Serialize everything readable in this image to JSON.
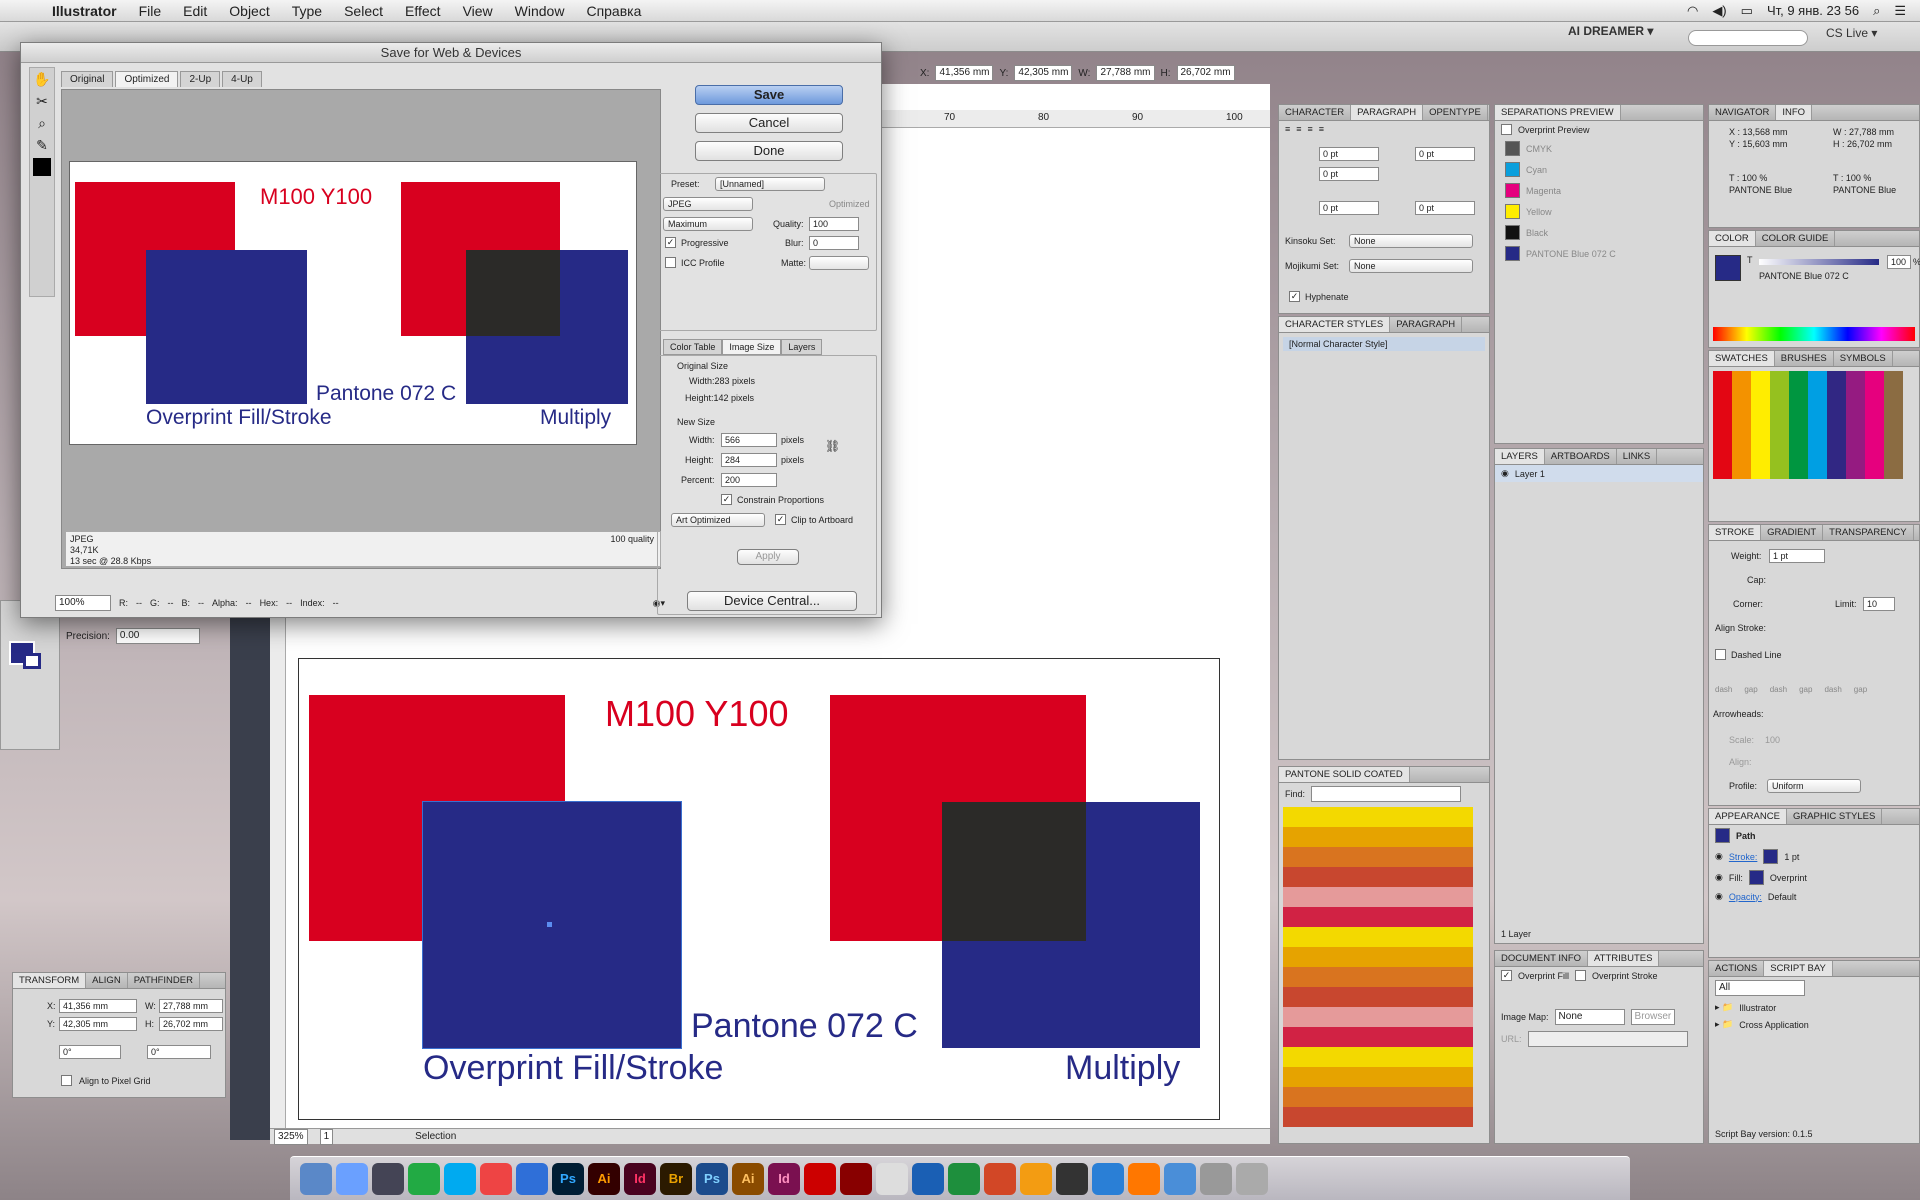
{
  "menubar": {
    "app": "Illustrator",
    "items": [
      "File",
      "Edit",
      "Object",
      "Type",
      "Select",
      "Effect",
      "View",
      "Window",
      "Справка"
    ],
    "clock": "Чт, 9 янв.  23 56"
  },
  "controlbar": {
    "workspace": "AI DREAMER ▾",
    "cslive": "CS Live ▾",
    "x_label": "X:",
    "x_value": "41,356 mm",
    "y_label": "Y:",
    "y_value": "42,305 mm",
    "w_label": "W:",
    "w_value": "27,788 mm",
    "h_label": "H:",
    "h_value": "26,702 mm"
  },
  "dialog": {
    "title": "Save for Web & Devices",
    "tabs": [
      "Original",
      "Optimized",
      "2-Up",
      "4-Up"
    ],
    "active_tab": "Optimized",
    "preview_text": {
      "m100y100": "M100 Y100",
      "pantone": "Pantone 072 C",
      "overprint": "Overprint Fill/Stroke",
      "multiply": "Multiply"
    },
    "info": {
      "format": "JPEG",
      "size": "34,71K",
      "time": "13 sec @ 28.8 Kbps",
      "quality": "100 quality"
    },
    "bottom": {
      "zoom": "100%",
      "r": "R:",
      "r_val": "--",
      "g": "G:",
      "g_val": "--",
      "b": "B:",
      "b_val": "--",
      "alpha": "Alpha:",
      "alpha_val": "--",
      "hex": "Hex:",
      "hex_val": "--",
      "index": "Index:",
      "index_val": "--"
    },
    "buttons": {
      "save": "Save",
      "cancel": "Cancel",
      "done": "Done",
      "device_central": "Device Central...",
      "apply": "Apply"
    },
    "preset_label": "Preset:",
    "preset_value": "[Unnamed]",
    "format_value": "JPEG",
    "compression": "Maximum",
    "optimized_label": "Optimized",
    "quality_label": "Quality:",
    "quality_value": "100",
    "progressive_label": "Progressive",
    "blur_label": "Blur:",
    "blur_value": "0",
    "icc_label": "ICC Profile",
    "matte_label": "Matte:",
    "subtabs": [
      "Color Table",
      "Image Size",
      "Layers"
    ],
    "original_size_label": "Original Size",
    "orig_width": "Width:283 pixels",
    "orig_height": "Height:142 pixels",
    "new_size_label": "New Size",
    "width_label": "Width:",
    "width_value": "566",
    "height_label": "Height:",
    "height_value": "284",
    "pixels": "pixels",
    "percent_label": "Percent:",
    "percent_value": "200",
    "constrain_label": "Constrain Proportions",
    "art_optimized": "Art Optimized",
    "clip_label": "Clip to Artboard"
  },
  "precision": {
    "label": "Precision:",
    "value": "0.00"
  },
  "artboard_text": {
    "m100y100": "M100 Y100",
    "pantone": "Pantone 072 C",
    "overprint": "Overprint Fill/Stroke",
    "multiply": "Multiply"
  },
  "ruler_top": [
    "70",
    "80",
    "90",
    "100"
  ],
  "statusbar": {
    "zoom": "325%",
    "page": "1",
    "tool": "Selection"
  },
  "transform_panel": {
    "tabs": [
      "TRANSFORM",
      "ALIGN",
      "PATHFINDER"
    ],
    "x": "41,356 mm",
    "y": "42,305 mm",
    "w": "27,788 mm",
    "h": "26,702 mm",
    "angle": "0°",
    "shear": "0°",
    "align_grid": "Align to Pixel Grid",
    "x_label": "X:",
    "y_label": "Y:",
    "w_label": "W:",
    "h_label": "H:"
  },
  "character_panel": {
    "tabs": [
      "CHARACTER",
      "PARAGRAPH",
      "OPENTYPE"
    ],
    "pt": "0 pt",
    "kinsoku_label": "Kinsoku Set:",
    "kinsoku_value": "None",
    "mojikumi_label": "Mojikumi Set:",
    "mojikumi_value": "None",
    "hyphenate": "Hyphenate"
  },
  "charstyles_panel": {
    "tabs": [
      "CHARACTER STYLES",
      "PARAGRAPH"
    ],
    "item": "[Normal Character Style]"
  },
  "pantone_panel": {
    "title": "PANTONE SOLID COATED",
    "find": "Find:"
  },
  "separations_panel": {
    "title": "SEPARATIONS PREVIEW",
    "overprint_preview": "Overprint Preview",
    "items": [
      {
        "name": "CMYK",
        "color": "#555555"
      },
      {
        "name": "Cyan",
        "color": "#0b9fdc"
      },
      {
        "name": "Magenta",
        "color": "#e5007e"
      },
      {
        "name": "Yellow",
        "color": "#ffed00"
      },
      {
        "name": "Black",
        "color": "#111111"
      },
      {
        "name": "PANTONE Blue 072 C",
        "color": "#262a86"
      }
    ]
  },
  "layers_panel": {
    "tabs": [
      "LAYERS",
      "ARTBOARDS",
      "LINKS"
    ],
    "layer": "Layer 1",
    "count": "1 Layer"
  },
  "docinfo_panel": {
    "tabs": [
      "DOCUMENT INFO",
      "ATTRIBUTES"
    ],
    "overprint_fill": "Overprint Fill",
    "overprint_stroke": "Overprint Stroke",
    "image_map_label": "Image Map:",
    "image_map_value": "None",
    "browser": "Browser",
    "url": "URL:"
  },
  "navigator_panel": {
    "tabs": [
      "NAVIGATOR",
      "INFO"
    ],
    "x": "X : 13,568 mm",
    "y": "Y : 15,603 mm",
    "w": "W : 27,788 mm",
    "h": "H : 26,702 mm",
    "t1": "T :  100 %",
    "t2": "T :  100 %",
    "c1": "PANTONE Blue",
    "c2": "PANTONE Blue"
  },
  "color_panel": {
    "tabs": [
      "COLOR",
      "COLOR GUIDE"
    ],
    "label": "PANTONE Blue 072 C",
    "tint": "100",
    "percent": "%",
    "t": "T"
  },
  "swatches_panel": {
    "tabs": [
      "SWATCHES",
      "BRUSHES",
      "SYMBOLS"
    ]
  },
  "stroke_panel": {
    "tabs": [
      "STROKE",
      "GRADIENT",
      "TRANSPARENCY"
    ],
    "weight_label": "Weight:",
    "weight_value": "1 pt",
    "cap": "Cap:",
    "corner": "Corner:",
    "limit_label": "Limit:",
    "limit_value": "10",
    "align_stroke": "Align Stroke:",
    "dashed": "Dashed Line",
    "dash_labels": [
      "dash",
      "gap",
      "dash",
      "gap",
      "dash",
      "gap"
    ],
    "arrowheads": "Arrowheads:",
    "scale": "Scale:",
    "scale_val": "100",
    "align": "Align:",
    "profile": "Profile:",
    "profile_value": "Uniform"
  },
  "appearance_panel": {
    "tabs": [
      "APPEARANCE",
      "GRAPHIC STYLES"
    ],
    "path": "Path",
    "stroke": "Stroke:",
    "stroke_value": "1 pt",
    "fill": "Fill:",
    "fill_value": "Overprint",
    "opacity": "Opacity:",
    "opacity_value": "Default"
  },
  "actions_panel": {
    "tabs": [
      "ACTIONS",
      "SCRIPT BAY"
    ],
    "filter": "All",
    "items": [
      "Illustrator",
      "Cross Application"
    ],
    "version": "Script Bay version: 0.1.5"
  },
  "dock": {
    "apps": [
      "Ps",
      "Ai",
      "Id",
      "Br",
      "Ps",
      "Ai",
      "Id"
    ]
  },
  "colors": {
    "red": "#d8001f",
    "blue": "#262a86",
    "overlap": "#2b2a28",
    "accent": "#3a70d0"
  }
}
